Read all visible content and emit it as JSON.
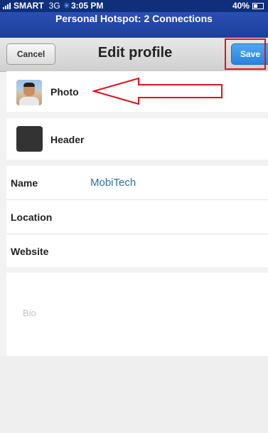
{
  "status_bar": {
    "carrier": "SMART",
    "network": "3G",
    "time": "3:05 PM",
    "battery": "40%",
    "battery_level": 0.4,
    "icons": [
      "signal-bars-icon",
      "activity-spinner-icon",
      "battery-icon"
    ]
  },
  "hotspot": {
    "text": "Personal Hotspot: 2 Connections"
  },
  "nav": {
    "cancel_label": "Cancel",
    "title": "Edit profile",
    "save_label": "Save"
  },
  "profile": {
    "photo_label": "Photo",
    "header_label": "Header"
  },
  "fields": [
    {
      "label": "Name",
      "value": "MobiTech"
    },
    {
      "label": "Location",
      "value": ""
    },
    {
      "label": "Website",
      "value": ""
    }
  ],
  "bio": {
    "placeholder": "Bio"
  },
  "annotation": {
    "color": "#e0131b"
  },
  "colors": {
    "status_bar": "#0e2f7a",
    "hotspot": "#2346a8",
    "save_button": "#3a93e6",
    "field_value": "#2f6fa8"
  }
}
